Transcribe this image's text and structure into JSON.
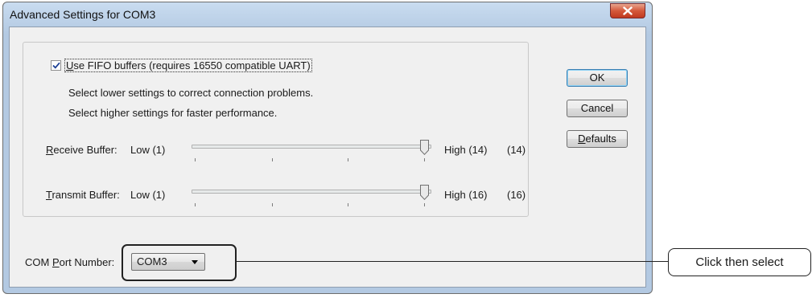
{
  "window": {
    "title": "Advanced Settings for COM3",
    "close_icon": "close-icon"
  },
  "fifo": {
    "checked": true,
    "label_pre": "",
    "label_ul": "U",
    "label_post": "se FIFO buffers (requires 16550 compatible UART)"
  },
  "info": {
    "line1": "Select lower settings to correct connection problems.",
    "line2": "Select higher settings for faster performance."
  },
  "receive": {
    "label_ul": "R",
    "label_post": "eceive Buffer:",
    "low": "Low (1)",
    "high": "High (14)",
    "value_text": "(14)",
    "min": 1,
    "max": 14,
    "value": 14
  },
  "transmit": {
    "label_ul": "T",
    "label_post": "ransmit Buffer:",
    "low": "Low (1)",
    "high": "High (16)",
    "value_text": "(16)",
    "min": 1,
    "max": 16,
    "value": 16
  },
  "buttons": {
    "ok": "OK",
    "cancel": "Cancel",
    "defaults_ul": "D",
    "defaults_post": "efaults"
  },
  "com_port": {
    "label_pre": "COM ",
    "label_ul": "P",
    "label_post": "ort Number:",
    "selected": "COM3"
  },
  "annotation": {
    "callout": "Click then select"
  },
  "colors": {
    "close_button": "#c0391f",
    "dialog_frame": "#b3c9e2",
    "client_bg": "#f0f0f0"
  }
}
